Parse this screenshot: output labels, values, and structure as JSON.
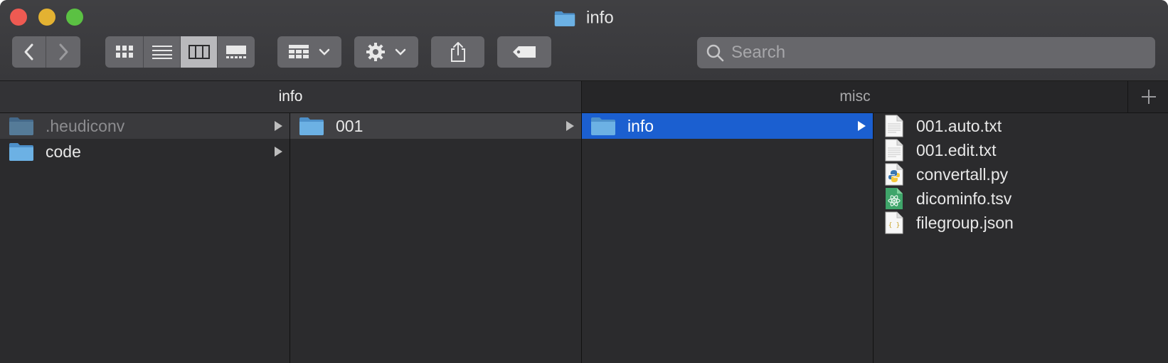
{
  "window": {
    "title": "info",
    "accent": "#1b5fd0"
  },
  "toolbar": {
    "back": "chevron-left-icon",
    "forward": "chevron-right-icon",
    "view_modes": [
      "icon-view",
      "list-view",
      "column-view",
      "gallery-view"
    ],
    "active_view": "column-view",
    "group_button": "group-by-icon",
    "action_button": "gear-icon",
    "share_button": "share-icon",
    "tag_button": "tag-icon"
  },
  "search": {
    "placeholder": "Search"
  },
  "tabs": [
    {
      "label": "info",
      "active": true
    },
    {
      "label": "misc",
      "active": false
    }
  ],
  "columns": {
    "col1": [
      {
        "name": ".heudiconv",
        "type": "folder",
        "state": "dimmed"
      },
      {
        "name": "code",
        "type": "folder",
        "state": "normal"
      }
    ],
    "col2": [
      {
        "name": "001",
        "type": "folder",
        "state": "path"
      }
    ],
    "col3": [
      {
        "name": "info",
        "type": "folder",
        "state": "selected"
      }
    ],
    "col4": [
      {
        "name": "001.auto.txt",
        "type": "text-file"
      },
      {
        "name": "001.edit.txt",
        "type": "text-file"
      },
      {
        "name": "convertall.py",
        "type": "python-file"
      },
      {
        "name": "dicominfo.tsv",
        "type": "tsv-file"
      },
      {
        "name": "filegroup.json",
        "type": "json-file"
      }
    ]
  }
}
